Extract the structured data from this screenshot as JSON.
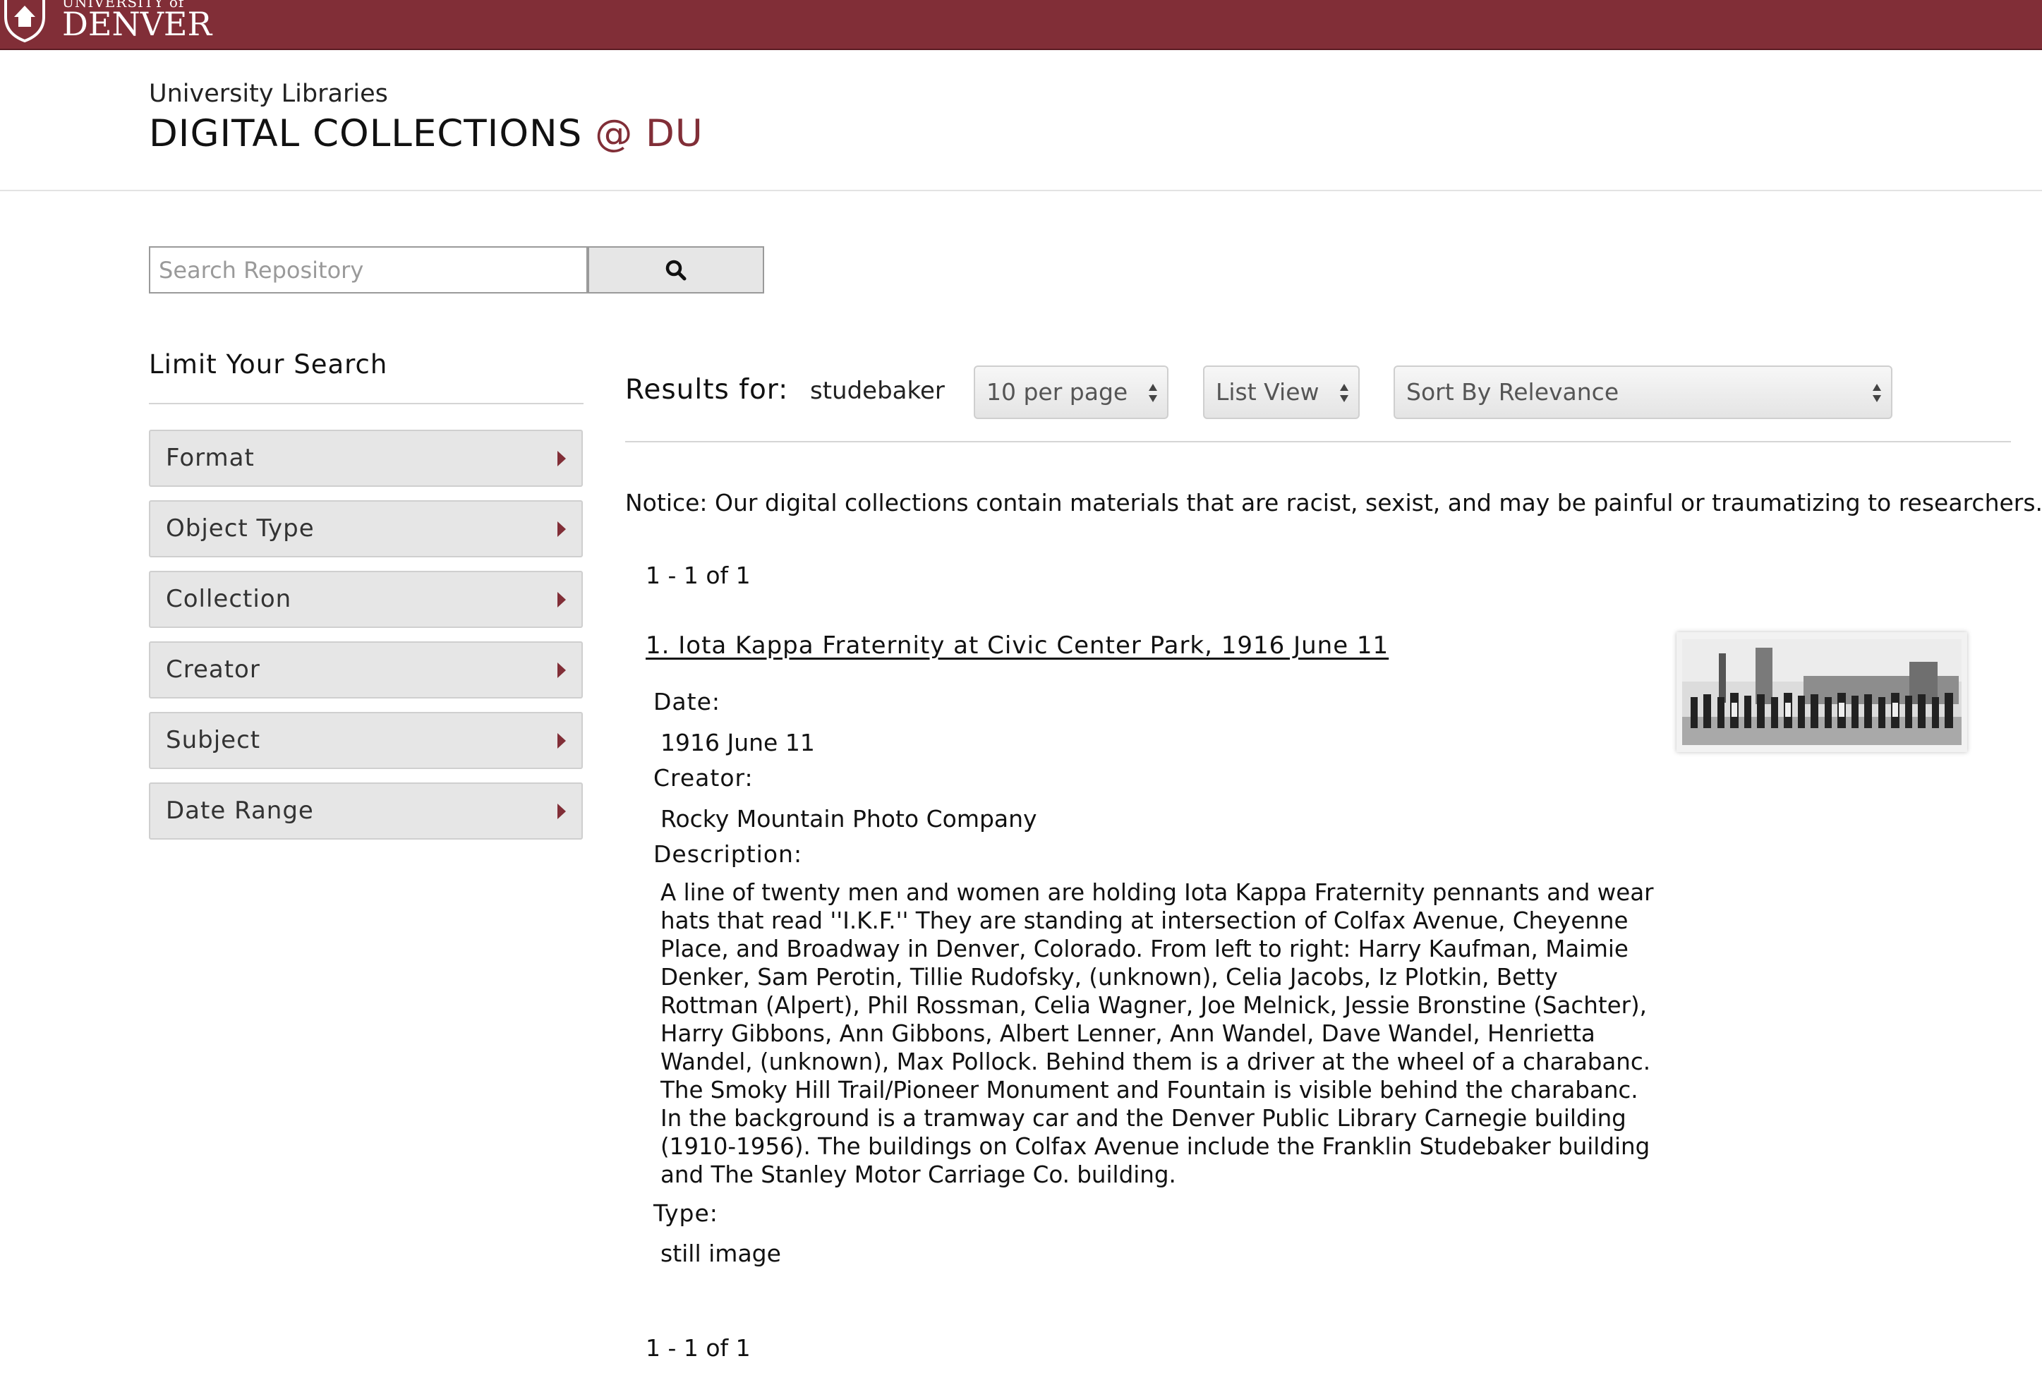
{
  "brand": {
    "university_line": "UNIVERSITY of",
    "name": "DENVER"
  },
  "header": {
    "library_label": "University Libraries",
    "title_main": "DIGITAL COLLECTIONS",
    "title_accent": "@ DU"
  },
  "search": {
    "placeholder": "Search Repository",
    "value": "",
    "button_icon": "search-icon"
  },
  "sidebar": {
    "title": "Limit Your Search",
    "facets": [
      {
        "label": "Format"
      },
      {
        "label": "Object Type"
      },
      {
        "label": "Collection"
      },
      {
        "label": "Creator"
      },
      {
        "label": "Subject"
      },
      {
        "label": "Date Range"
      }
    ]
  },
  "results": {
    "results_for_label": "Results for:",
    "query": "studebaker",
    "per_page": "10 per page",
    "view": "List View",
    "sort": "Sort By Relevance",
    "notice": "Notice: Our digital collections contain materials that are racist, sexist, and may be painful or traumatizing to researchers.",
    "count_top": "1 - 1 of 1",
    "count_bottom": "1 - 1 of 1",
    "items": [
      {
        "title": "1.  Iota Kappa Fraternity at Civic Center Park, 1916 June 11",
        "date_label": "Date:",
        "date": "1916 June 11",
        "creator_label": "Creator:",
        "creator": "Rocky Mountain Photo Company",
        "description_label": "Description:",
        "description": "A line of twenty men and women are holding Iota Kappa Fraternity pennants and wear hats that read ''I.K.F.'' They are standing at intersection of Colfax Avenue, Cheyenne Place, and Broadway in Denver, Colorado. From left to right: Harry Kaufman, Maimie Denker, Sam Perotin, Tillie Rudofsky, (unknown), Celia Jacobs, Iz Plotkin, Betty Rottman (Alpert), Phil Rossman, Celia Wagner, Joe Melnick, Jessie Bronstine (Sachter), Harry Gibbons, Ann Gibbons, Albert Lenner, Ann Wandel, Dave Wandel, Henrietta Wandel, (unknown), Max Pollock. Behind them is a driver at the wheel of a charabanc. The Smoky Hill Trail/Pioneer Monument and Fountain is visible behind the charabanc. In the background is a tramway car and the Denver Public Library Carnegie building (1910-1956). The buildings on Colfax Avenue include the Franklin Studebaker building and The Stanley Motor Carriage Co. building.",
        "type_label": "Type:",
        "type": "still image"
      }
    ]
  },
  "colors": {
    "brand": "#812e37",
    "facet_bg": "#e6e6e6"
  }
}
